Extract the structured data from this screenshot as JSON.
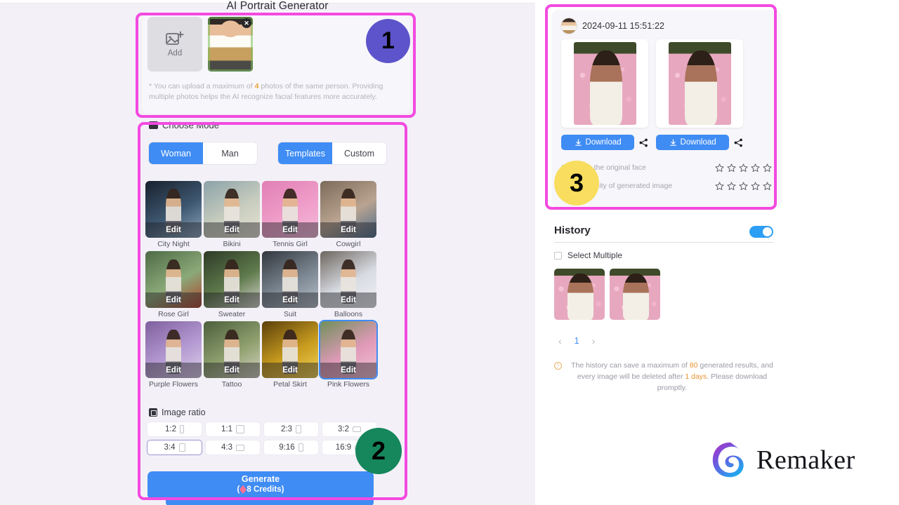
{
  "page": {
    "title": "AI Portrait Generator"
  },
  "upload": {
    "add_label": "Add",
    "close_icon": "✕",
    "hint_prefix": "* You can upload a maximum of ",
    "hint_count": "4",
    "hint_suffix": " photos of the same person. Providing multiple photos helps the AI recognize facial features more accurately."
  },
  "mode": {
    "title": "Choose Mode",
    "gender": {
      "options": [
        "Woman",
        "Man"
      ],
      "selected": "Woman"
    },
    "source": {
      "options": [
        "Templates",
        "Custom"
      ],
      "selected": "Templates"
    }
  },
  "templates": {
    "edit_label": "Edit",
    "selected": "Pink Flowers",
    "items": [
      {
        "name": "City Night",
        "c1": "#17202c",
        "c2": "#3e5871",
        "c3": "#8fa6bd"
      },
      {
        "name": "Bikini",
        "c1": "#8ba2a8",
        "c2": "#c8cdbf",
        "c3": "#e8e3d4"
      },
      {
        "name": "Tennis Girl",
        "c1": "#e17fb4",
        "c2": "#ef9ec9",
        "c3": "#f5bbdb"
      },
      {
        "name": "Cowgirl",
        "c1": "#7d6a59",
        "c2": "#b9a390",
        "c3": "#4d6c8c"
      },
      {
        "name": "Rose Girl",
        "c1": "#4e6b46",
        "c2": "#8aa978",
        "c3": "#b0432f"
      },
      {
        "name": "Sweater",
        "c1": "#2d3a26",
        "c2": "#5f7a4c",
        "c3": "#d9d7cf"
      },
      {
        "name": "Suit",
        "c1": "#32373d",
        "c2": "#7b8792",
        "c3": "#b9c2cb"
      },
      {
        "name": "Balloons",
        "c1": "#6d665f",
        "c2": "#d8dbe2",
        "c3": "#f0f2f6"
      },
      {
        "name": "Purple Flowers",
        "c1": "#7f5f9e",
        "c2": "#b49ad2",
        "c3": "#ddcfe9"
      },
      {
        "name": "Tattoo",
        "c1": "#4b5e3c",
        "c2": "#8fa06e",
        "c3": "#d6d2c4"
      },
      {
        "name": "Petal Skirt",
        "c1": "#5a3f0c",
        "c2": "#c79b1e",
        "c3": "#f2d256"
      },
      {
        "name": "Pink Flowers",
        "c1": "#6f8f5a",
        "c2": "#e09ab8",
        "c3": "#f3c3d6"
      }
    ]
  },
  "ratio": {
    "title": "Image ratio",
    "options": [
      "1:2",
      "1:1",
      "2:3",
      "3:2",
      "3:4",
      "4:3",
      "9:16",
      "16:9"
    ],
    "selected": "3:4"
  },
  "generate": {
    "label": "Generate",
    "credits_open": "(",
    "credits_text": "8 Credits)"
  },
  "result": {
    "timestamp": "2024-09-11 15:51:22",
    "download_label": "Download",
    "share_icon": "share-icon",
    "ratings": [
      {
        "label": "Similar to the original face",
        "value": 0,
        "max": 5
      },
      {
        "label": "Artistic quality of generated image",
        "value": 0,
        "max": 5
      }
    ]
  },
  "history": {
    "title": "History",
    "toggle_on": true,
    "select_multiple_label": "Select Multiple",
    "thumbs": 2,
    "pager": {
      "prev": "‹",
      "page": "1",
      "next": "›"
    },
    "note_p1": "The history can save a maximum of ",
    "note_max": "80",
    "note_p2": " generated results, and every image will be deleted after ",
    "note_days": "1 days",
    "note_p3": ". Please download promptly."
  },
  "brand": {
    "name": "Remaker"
  },
  "annotations": {
    "badges": [
      {
        "num": "1",
        "color": "#5d54cb"
      },
      {
        "num": "2",
        "color": "#16865c"
      },
      {
        "num": "3",
        "color": "#f8dd5f"
      }
    ],
    "box_color": "#f34ae0"
  }
}
